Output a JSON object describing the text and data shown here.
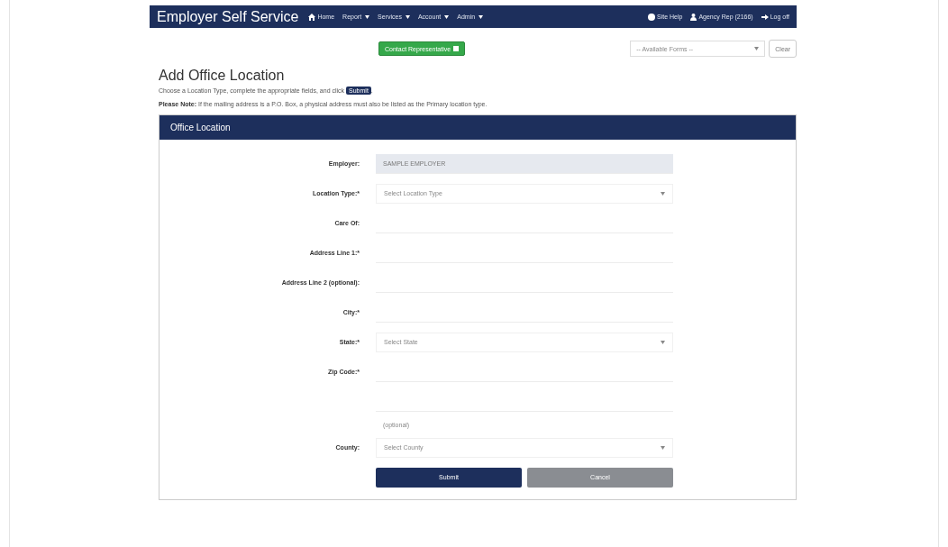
{
  "navbar": {
    "brand": "Employer Self Service",
    "items": [
      {
        "label": "Home",
        "kind": "home",
        "dropdown": false
      },
      {
        "label": "Report",
        "dropdown": true
      },
      {
        "label": "Services",
        "dropdown": true
      },
      {
        "label": "Account",
        "dropdown": true
      },
      {
        "label": "Admin",
        "dropdown": true
      }
    ],
    "right_items": [
      {
        "label": "Site Help",
        "kind": "help"
      },
      {
        "label": "Agency Rep (2166)",
        "kind": "user"
      },
      {
        "label": "Log off",
        "kind": "logoff"
      }
    ]
  },
  "toolbar": {
    "contact_button": "Contact Representative",
    "forms_select": {
      "placeholder": "-- Available Forms --"
    },
    "clear_button": "Clear"
  },
  "page_title": "Add Office Location",
  "instruction": {
    "text": "Choose a Location Type, complete the appropriate fields, and click",
    "badge": "Submit",
    "end": "."
  },
  "note": "**Please Note:** If the mailing address is a P.O. Box, a physical address must also be listed as the Primary location type.",
  "panel": {
    "title": "Office Location",
    "fields": [
      {
        "label": "Employer:",
        "kind": "readonly",
        "value": "SAMPLE EMPLOYER"
      },
      {
        "label": "Location Type:*",
        "kind": "select",
        "placeholder": "Select Location Type"
      },
      {
        "label": "Care Of:",
        "kind": "input"
      },
      {
        "label": "Address Line 1:*",
        "kind": "input"
      },
      {
        "label": "Address Line 2 (optional):",
        "kind": "input"
      },
      {
        "label": "City:*",
        "kind": "input"
      },
      {
        "label": "State:*",
        "kind": "select",
        "placeholder": "Select State"
      },
      {
        "label": "Zip Code:*",
        "kind": "input"
      },
      {
        "kind": "input"
      },
      {
        "label": "County:",
        "kind": "select",
        "placeholder": "Select County",
        "hint": "(optional)"
      }
    ],
    "submit": "Submit",
    "cancel": "Cancel"
  }
}
